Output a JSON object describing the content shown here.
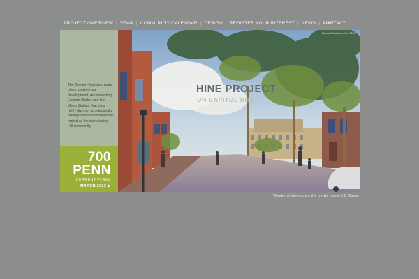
{
  "nav": {
    "items": [
      {
        "label": "PROJECT OVERVIEW"
      },
      {
        "label": "TEAM"
      },
      {
        "label": "COMMUNITY CALENDAR"
      },
      {
        "label": "DESIGN"
      },
      {
        "label": "REGISTER YOUR INTEREST"
      },
      {
        "label": "NEWS"
      },
      {
        "label": "PUD"
      }
    ],
    "separator": "|",
    "contact": "CONTACT"
  },
  "sidebar": {
    "description": "The Stanton-Eastbanc team plans a mixed-use development, re-connecting Eastern Market and the Metro Station, that is as richly diverse, architecturally distinguished and historically rooted as the surrounding Hill community."
  },
  "brand": {
    "line1": "700",
    "line2": "PENN",
    "subtitle": "CURRENT PLANS",
    "date": "MARCH 2013",
    "arrow": "▶"
  },
  "hero": {
    "title": "HINE PROJECT",
    "subtitle": "ON CAPITOL HILL",
    "copyright": "Stanton/Eastbanc Hine 2012"
  },
  "caption": "Weekend view down the newly opened C Street",
  "colors": {
    "background": "#8c8e8d",
    "side_panel": "#aab8a2",
    "brand_green": "#9bb039"
  }
}
